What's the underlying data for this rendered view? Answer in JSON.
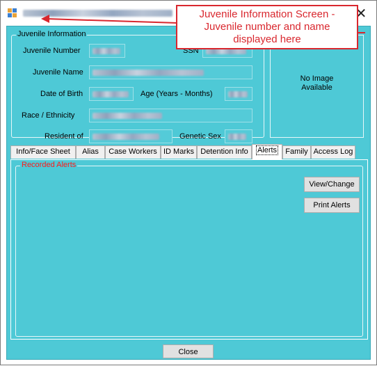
{
  "window": {
    "close_glyph": "✕"
  },
  "annotation": {
    "line1": "Juvenile Information Screen -",
    "line2": "Juvenile number and name",
    "line3": "displayed here",
    "color": "#d9272e"
  },
  "juvenile_info": {
    "group_title": "Juvenile Information",
    "juvenile_number_label": "Juvenile Number",
    "ssn_label": "SSN",
    "juvenile_name_label": "Juvenile Name",
    "dob_label": "Date of Birth",
    "age_label": "Age (Years - Months)",
    "race_label": "Race / Ethnicity",
    "resident_label": "Resident of",
    "genetic_sex_label": "Genetic Sex"
  },
  "photo": {
    "no_image_line1": "No Image",
    "no_image_line2": "Available"
  },
  "tabs": [
    {
      "label": "Info/Face Sheet"
    },
    {
      "label": "Alias"
    },
    {
      "label": "Case Workers"
    },
    {
      "label": "ID Marks"
    },
    {
      "label": "Detention Info"
    },
    {
      "label": "Alerts"
    },
    {
      "label": "Family"
    },
    {
      "label": "Access Log"
    }
  ],
  "active_tab": "Alerts",
  "alerts": {
    "group_title": "Recorded Alerts",
    "group_title_color": "#ff1a1a",
    "view_change_button": "View/Change",
    "print_alerts_button": "Print Alerts"
  },
  "footer": {
    "close_button": "Close"
  },
  "colors": {
    "form_background": "#4ec9d6"
  }
}
